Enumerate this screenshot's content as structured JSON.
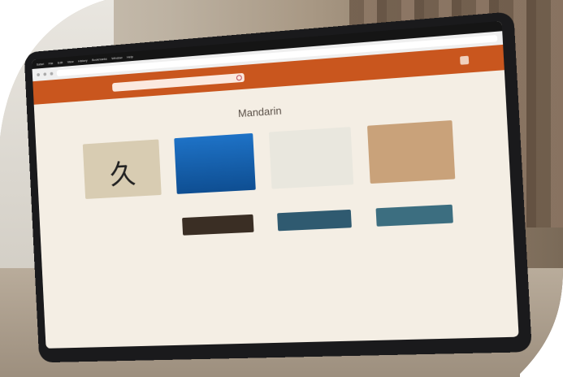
{
  "menubar": {
    "items": [
      "Safari",
      "File",
      "Edit",
      "View",
      "History",
      "Bookmarks",
      "Window",
      "Help"
    ]
  },
  "browser": {
    "url": ""
  },
  "site": {
    "logo": "",
    "logo2": "",
    "search_placeholder": "",
    "header_link": ""
  },
  "page": {
    "subtitle": "",
    "title": "Mandarin",
    "cards": [
      {
        "caption": "",
        "meta": ""
      },
      {
        "caption": "",
        "meta": ""
      },
      {
        "caption": "",
        "meta": ""
      },
      {
        "caption": "",
        "meta": ""
      }
    ]
  },
  "colors": {
    "brand": "#c9561e",
    "page_bg": "#f4eee4"
  }
}
